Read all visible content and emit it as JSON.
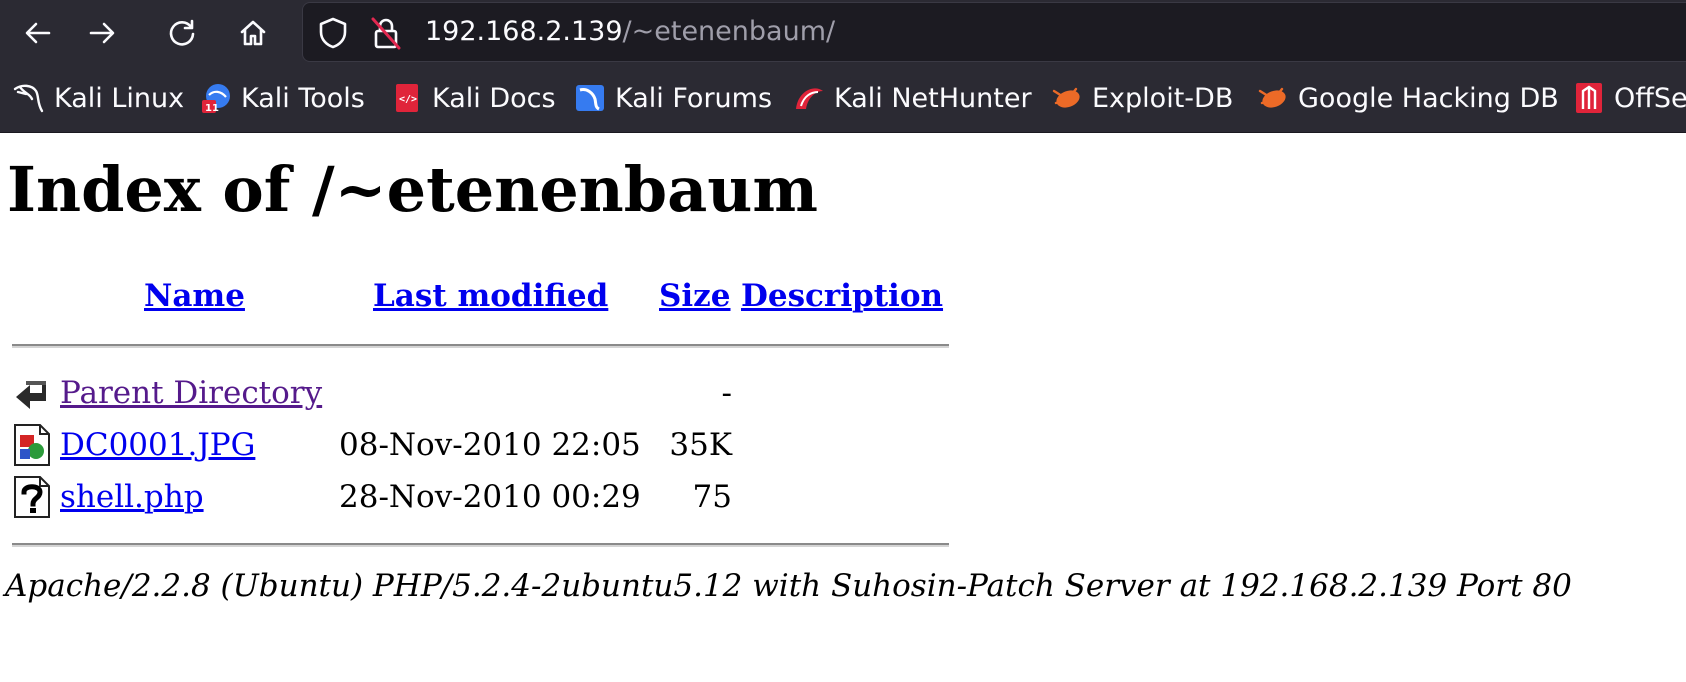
{
  "browser": {
    "url_host": "192.168.2.139",
    "url_path": "/~etenenbaum/",
    "nav_icons": [
      "back-arrow-icon",
      "forward-arrow-icon",
      "reload-icon",
      "home-icon",
      "shield-icon",
      "insecure-lock-icon"
    ],
    "bookmarks": [
      {
        "label": "Kali Linux",
        "icon": "kali-dragon-icon"
      },
      {
        "label": "Kali Tools",
        "icon": "kali-tools-icon"
      },
      {
        "label": "Kali Docs",
        "icon": "kali-docs-icon"
      },
      {
        "label": "Kali Forums",
        "icon": "kali-forums-icon"
      },
      {
        "label": "Kali NetHunter",
        "icon": "kali-nethunter-icon"
      },
      {
        "label": "Exploit-DB",
        "icon": "exploit-db-icon"
      },
      {
        "label": "Google Hacking DB",
        "icon": "ghdb-icon"
      },
      {
        "label": "OffSe",
        "icon": "offsec-icon"
      }
    ]
  },
  "page": {
    "title": "Index of /~etenenbaum",
    "columns": {
      "name": "Name",
      "last_modified": "Last modified",
      "size": "Size",
      "description": "Description"
    },
    "rows": [
      {
        "icon": "parent-directory-icon",
        "name": "Parent Directory",
        "modified": "",
        "size": "-",
        "visited": true
      },
      {
        "icon": "image-file-icon",
        "name": "DC0001.JPG",
        "modified": "08-Nov-2010 22:05",
        "size": "35K",
        "visited": false
      },
      {
        "icon": "unknown-file-icon",
        "name": "shell.php",
        "modified": "28-Nov-2010 00:29",
        "size": "75",
        "visited": false
      }
    ],
    "address": "Apache/2.2.8 (Ubuntu) PHP/5.2.4-2ubuntu5.12 with Suhosin-Patch Server at 192.168.2.139 Port 80"
  },
  "colors": {
    "chrome_bg": "#2b2a33",
    "urlbar_bg": "#1c1b22",
    "link": "#0000ee",
    "visited_link": "#551a8b"
  }
}
